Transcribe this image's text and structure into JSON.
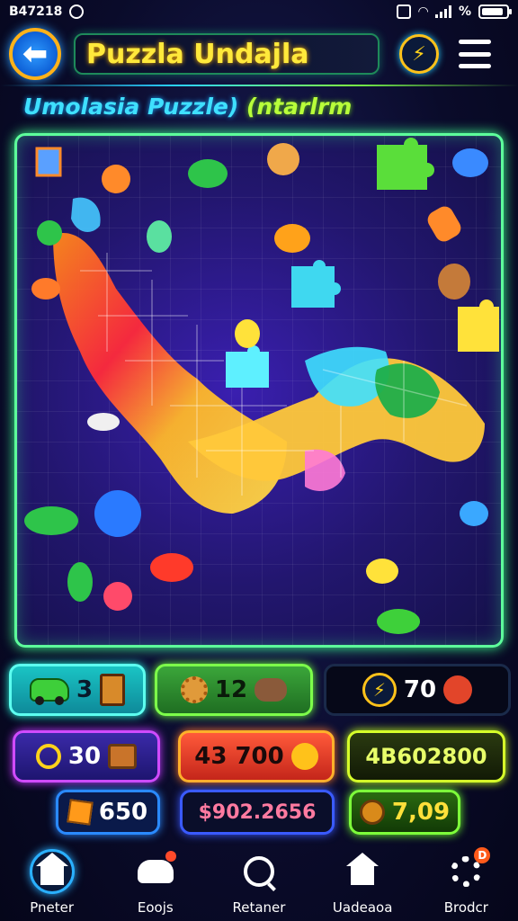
{
  "status_bar": {
    "time": "B47218",
    "battery_label": "%",
    "battery_fraction": 0.9
  },
  "header": {
    "title": "Puzzla Undajla",
    "back_icon": "back-arrow-icon",
    "power_icon": "bolt-icon",
    "menu_icon": "hamburger-menu-icon"
  },
  "subtitle": {
    "main": "Umolasia Puzzle)",
    "extra": "(ntarlrm"
  },
  "stats": {
    "cars": "3",
    "pieces": "12",
    "energy": "70",
    "coins": "30",
    "score": "43 700",
    "total": "4B602800",
    "boxes": "650",
    "money": "$902.2656",
    "time": "7,09"
  },
  "nav": [
    {
      "label": "Pneter",
      "icon": "home-icon"
    },
    {
      "label": "Eoojs",
      "icon": "pet-icon"
    },
    {
      "label": "Retaner",
      "icon": "search-icon"
    },
    {
      "label": "Uadeaoa",
      "icon": "house-icon"
    },
    {
      "label": "Brodcr",
      "icon": "gear-icon"
    }
  ],
  "colors": {
    "board_border": "#5dff9b",
    "title_text": "#ffe93b",
    "subtitle_main": "#3fe0ff",
    "subtitle_extra": "#b8ff3a"
  }
}
